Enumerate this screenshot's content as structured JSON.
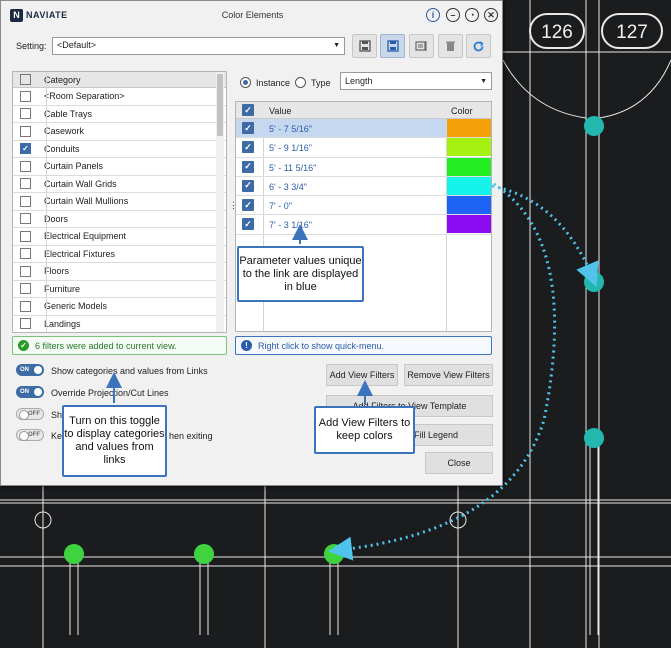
{
  "app": {
    "logo_text": "NAVIATE",
    "title": "Color Elements"
  },
  "setting": {
    "label": "Setting:",
    "value": "<Default>"
  },
  "category": {
    "header": "Category",
    "items": [
      {
        "label": "<Room Separation>",
        "checked": false
      },
      {
        "label": "Cable Trays",
        "checked": false
      },
      {
        "label": "Casework",
        "checked": false
      },
      {
        "label": "Conduits",
        "checked": true
      },
      {
        "label": "Curtain Panels",
        "checked": false
      },
      {
        "label": "Curtain Wall Grids",
        "checked": false
      },
      {
        "label": "Curtain Wall Mullions",
        "checked": false
      },
      {
        "label": "Doors",
        "checked": false
      },
      {
        "label": "Electrical Equipment",
        "checked": false
      },
      {
        "label": "Electrical Fixtures",
        "checked": false
      },
      {
        "label": "Floors",
        "checked": false
      },
      {
        "label": "Furniture",
        "checked": false
      },
      {
        "label": "Generic Models",
        "checked": false
      },
      {
        "label": "Landings",
        "checked": false
      }
    ]
  },
  "mode": {
    "instance_label": "Instance",
    "type_label": "Type",
    "selected": "Instance"
  },
  "parameter": {
    "value": "Length"
  },
  "values_table": {
    "header_value": "Value",
    "header_color": "Color",
    "rows": [
      {
        "value": "5' - 7 5/16\"",
        "color": "#f5a20a",
        "selected": true
      },
      {
        "value": "5' - 9 1/16\"",
        "color": "#a6f012"
      },
      {
        "value": "5' - 11 5/16\"",
        "color": "#22ee22"
      },
      {
        "value": "6' - 3 3/4\"",
        "color": "#16f3ea"
      },
      {
        "value": "7' - 0\"",
        "color": "#1e63f5"
      },
      {
        "value": "7' - 3 1/16\"",
        "color": "#8a0bf2"
      }
    ]
  },
  "messages": {
    "success": "6 filters were added to current view.",
    "info": "Right click to show quick-menu."
  },
  "toggles": [
    {
      "state": "ON",
      "label": "Show categories and values from Links"
    },
    {
      "state": "ON",
      "label": "Override Projection/Cut Lines"
    },
    {
      "state": "OFF",
      "label": "Sh"
    },
    {
      "state": "OFF",
      "label": "Ke",
      "label_tail": "hen exiting"
    }
  ],
  "buttons": {
    "add_view_filters": "Add View Filters",
    "remove_view_filters": "Remove View Filters",
    "add_filters_template": "Add Filters to View Template",
    "fill_legend": "Fill Legend",
    "close": "Close"
  },
  "callouts": {
    "parameter_values": "Parameter values unique to the link are displayed in blue",
    "toggle": "Turn on this toggle to display categories and values from links",
    "add_filters": "Add View Filters to keep colors"
  },
  "grid_tags": [
    "126",
    "127"
  ],
  "colors": {
    "accent": "#3d6ba6",
    "success": "#2a9a2a",
    "info": "#3b74bd",
    "node_cyan": "#22b8b0",
    "node_green": "#3fd33f",
    "link_blue": "#2a5caa"
  }
}
